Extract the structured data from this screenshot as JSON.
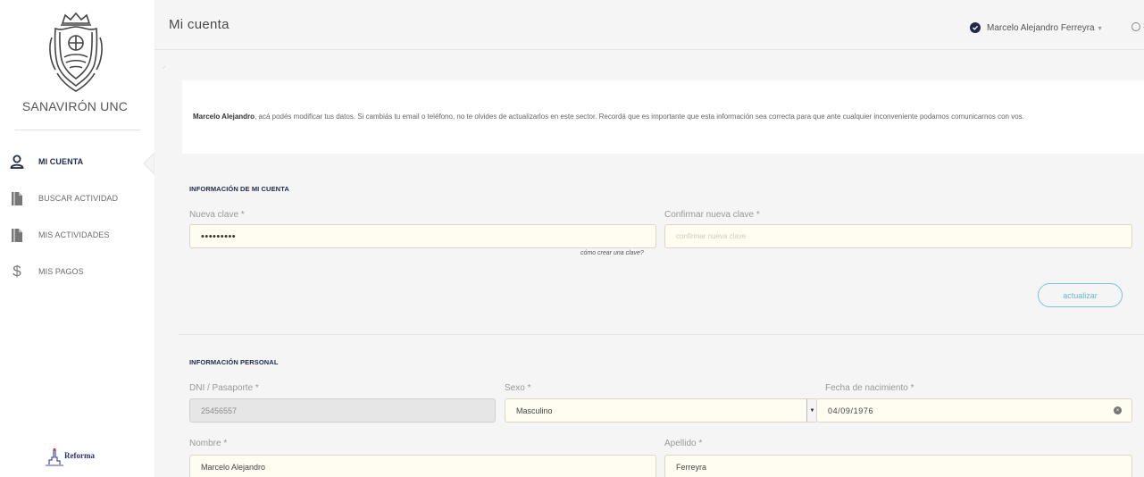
{
  "sidebar": {
    "brand": "SANAVIRÓN UNC",
    "items": [
      {
        "label": "MI CUENTA",
        "icon": "user-icon",
        "active": true
      },
      {
        "label": "BUSCAR ACTIVIDAD",
        "icon": "document-icon",
        "active": false
      },
      {
        "label": "MIS ACTIVIDADES",
        "icon": "document-icon",
        "active": false
      },
      {
        "label": "MIS PAGOS",
        "icon": "dollar-icon",
        "active": false
      }
    ],
    "footer_logo": "Reforma"
  },
  "header": {
    "title": "Mi cuenta",
    "user_name": "Marcelo Alejandro Ferreyra",
    "user_chevron": "▾",
    "salir": "Sa"
  },
  "info": {
    "name": "Marcelo Alejandro",
    "message": ", acá podés modificar tus datos. Si cambiás tu email o teléfono, no te olvides de actualizarlos en este sector. Recordá que es importante que esta información sea correcta para que ante cualquier inconveniente podamos comunicarnos con vos."
  },
  "account": {
    "section_title": "INFORMACIÓN DE MI CUENTA",
    "new_password_label": "Nueva clave *",
    "new_password_value": "•••••••••",
    "confirm_password_label": "Confirmar nueva clave *",
    "confirm_password_placeholder": "confirmar nueva clave",
    "help_link": "cómo crear una clave?",
    "update_button": "actualizar"
  },
  "personal": {
    "section_title": "INFORMACIÓN PERSONAL",
    "dni_label": "DNI / Pasaporte *",
    "dni_value": "25456557",
    "sexo_label": "Sexo *",
    "sexo_value": "Masculino",
    "birth_label": "Fecha de nacimiento *",
    "birth_value": "04/09/1976",
    "nombre_label": "Nombre *",
    "nombre_value": "Marcelo Alejandro",
    "apellido_label": "Apellido *",
    "apellido_value": "Ferreyra"
  },
  "colors": {
    "brand_dark": "#1e2a4a",
    "accent": "#7ac4d8",
    "field_bg": "#fffcf1",
    "main_bg": "#f5f5f5"
  }
}
